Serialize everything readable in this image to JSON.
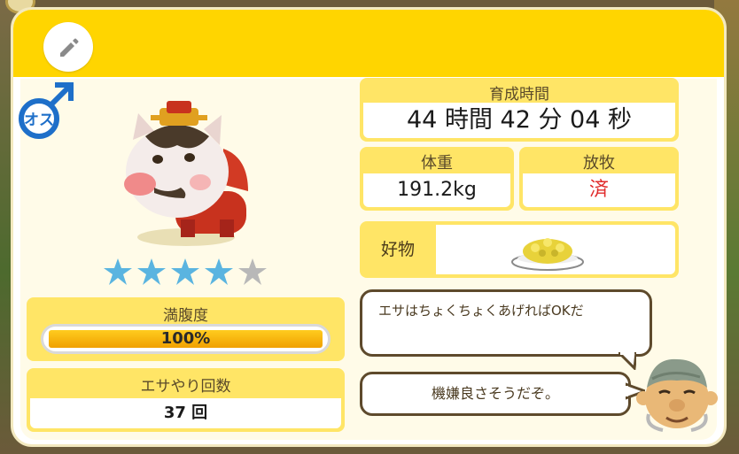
{
  "pet": {
    "gender_label": "オス",
    "star_rating": 4,
    "star_max": 5
  },
  "stats": {
    "hunger_label": "満腹度",
    "hunger_value": "100%",
    "hunger_fraction": 1.0,
    "feed_count_label": "エサやり回数",
    "feed_count_value": "37 回",
    "grow_time_label": "育成時間",
    "grow_time_value": "44 時間 42 分 04 秒",
    "weight_label": "体重",
    "weight_value": "191.2kg",
    "graze_label": "放牧",
    "graze_value": "済",
    "favorite_label": "好物"
  },
  "dialog": {
    "tip": "エサはちょくちょくあげればOKだ",
    "mood": "機嫌良さそうだぞ。"
  },
  "colors": {
    "header": "#ffd500",
    "star_on": "#5ab4e0",
    "star_off": "#b8b8b8",
    "gender": "#1e6fc9",
    "graze_value": "#e02b2b"
  }
}
